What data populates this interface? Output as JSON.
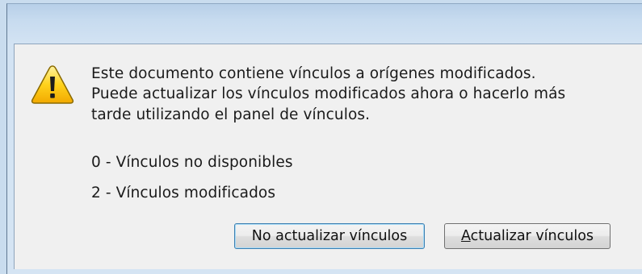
{
  "dialog": {
    "message_lines": [
      "Este documento contiene vínculos a orígenes modificados.",
      "Puede actualizar los vínculos modificados ahora o hacerlo más",
      "tarde utilizando el panel de vínculos."
    ],
    "stats": [
      "0 - Vínculos no disponibles",
      "2 - Vínculos modificados"
    ],
    "icon": "warning-triangle-icon",
    "buttons": {
      "no_update": "No actualizar vínculos",
      "update_accel": "A",
      "update_rest": "ctualizar vínculos"
    }
  }
}
